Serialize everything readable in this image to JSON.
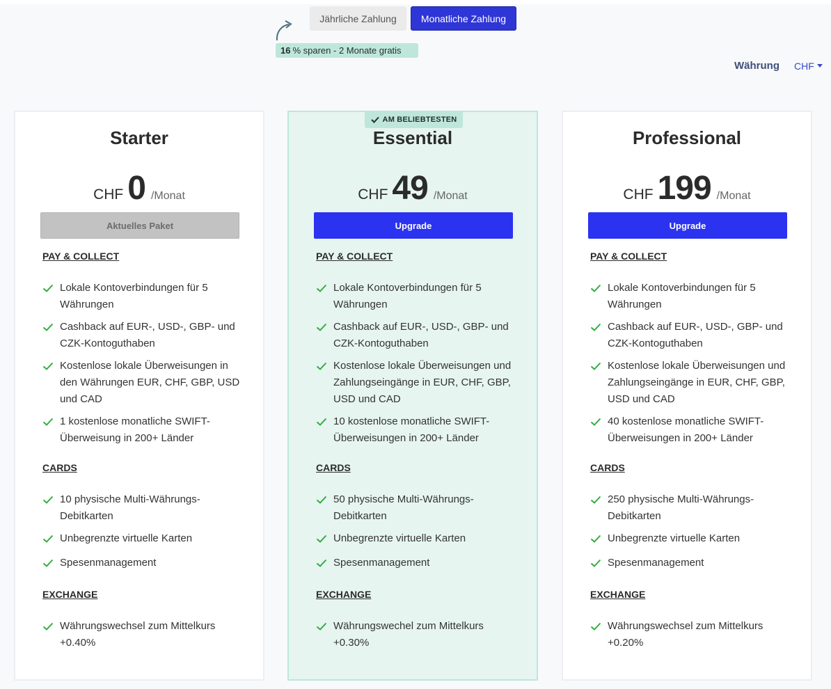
{
  "billing": {
    "yearly_label": "Jährliche Zahlung",
    "monthly_label": "Monatliche Zahlung",
    "savings_bold": "16",
    "savings_text": "% sparen - 2 Monate gratis"
  },
  "currency": {
    "label": "Währung",
    "selected": "CHF"
  },
  "popular_badge": "AM BELIEBTESTEN",
  "colors": {
    "accent": "#2b32f0",
    "highlight": "#bfe6da",
    "check": "#2fae3e"
  },
  "plans": [
    {
      "name": "Starter",
      "currency": "CHF",
      "amount": "0",
      "period": "/Monat",
      "cta": "Aktuelles Paket",
      "sections": [
        {
          "title": "PAY & COLLECT",
          "features": [
            "Lokale Kontoverbindungen für 5 Währungen",
            "Cashback auf EUR-, USD-, GBP- und CZK-Kontoguthaben",
            "Kostenlose lokale Überweisungen in den Währungen EUR, CHF, GBP, USD und CAD",
            "1 kostenlose monatliche SWIFT-Überweisung in 200+ Länder"
          ]
        },
        {
          "title": "CARDS",
          "features": [
            "10 physische Multi-Währungs-Debitkarten",
            "Unbegrenzte virtuelle Karten",
            "Spesenmanagement"
          ]
        },
        {
          "title": "EXCHANGE",
          "features": [
            "Währungswechsel zum Mittelkurs +0.40%"
          ]
        }
      ]
    },
    {
      "name": "Essential",
      "currency": "CHF",
      "amount": "49",
      "period": "/Monat",
      "cta": "Upgrade",
      "sections": [
        {
          "title": "PAY & COLLECT",
          "features": [
            "Lokale Kontoverbindungen für 5 Währungen",
            "Cashback auf EUR-, USD-, GBP- und CZK-Kontoguthaben",
            "Kostenlose lokale Überweisungen und Zahlungseingänge in EUR, CHF, GBP, USD und CAD",
            "10 kostenlose monatliche SWIFT-Überweisungen in 200+ Länder"
          ]
        },
        {
          "title": "CARDS",
          "features": [
            "50 physische Multi-Währungs-Debitkarten",
            "Unbegrenzte virtuelle Karten",
            "Spesenmanagement"
          ]
        },
        {
          "title": "EXCHANGE",
          "features": [
            "Währungswechel zum Mittelkurs +0.30%"
          ]
        }
      ]
    },
    {
      "name": "Professional",
      "currency": "CHF",
      "amount": "199",
      "period": "/Monat",
      "cta": "Upgrade",
      "sections": [
        {
          "title": "PAY & COLLECT",
          "features": [
            "Lokale Kontoverbindungen für 5 Währungen",
            "Cashback auf EUR-, USD-, GBP- und CZK-Kontoguthaben",
            "Kostenlose lokale Überweisungen und Zahlungseingänge in EUR, CHF, GBP, USD und CAD",
            "40 kostenlose monatliche SWIFT-Überweisungen in 200+ Länder"
          ]
        },
        {
          "title": "CARDS",
          "features": [
            "250 physische Multi-Währungs-Debitkarten",
            "Unbegrenzte virtuelle Karten",
            "Spesenmanagement"
          ]
        },
        {
          "title": "EXCHANGE",
          "features": [
            "Währungswechsel zum Mittelkurs +0.20%"
          ]
        }
      ]
    }
  ]
}
